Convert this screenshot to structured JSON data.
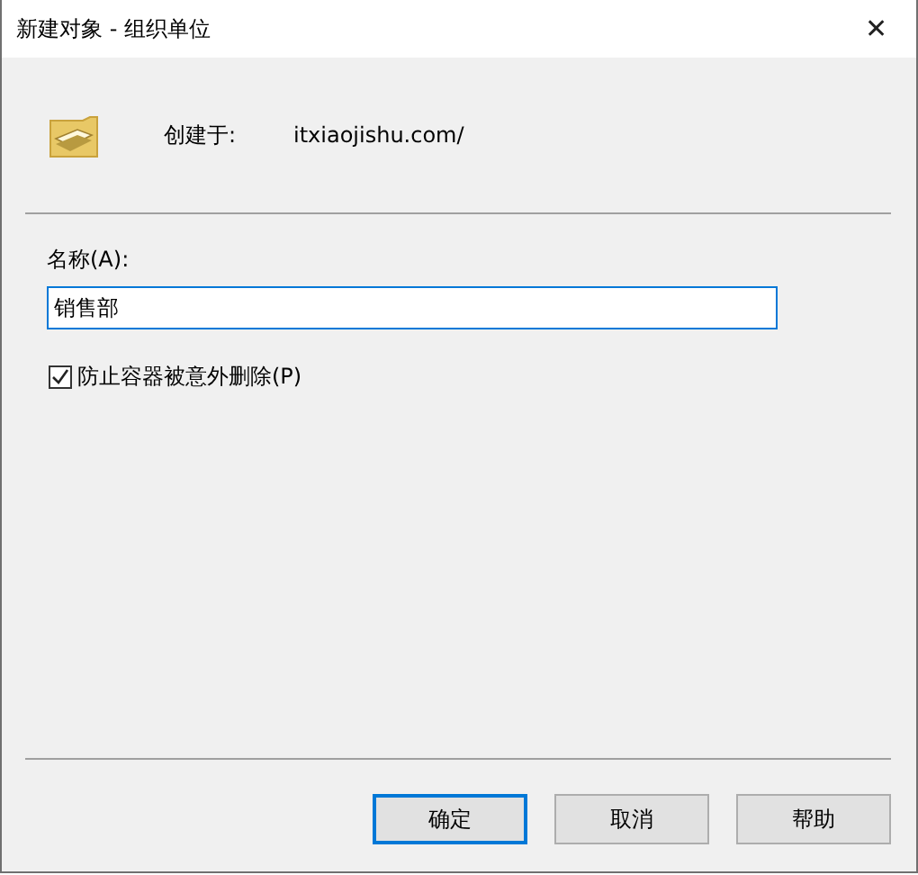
{
  "window": {
    "title": "新建对象 - 组织单位",
    "close": "✕"
  },
  "header": {
    "label": "创建于:",
    "value": "itxiaojishu.com/"
  },
  "name_field": {
    "label": "名称(A):",
    "value": "销售部"
  },
  "protect": {
    "label": "防止容器被意外删除(P)",
    "checked": true
  },
  "buttons": [
    {
      "label": "确定",
      "default": true
    },
    {
      "label": "取消",
      "default": false
    },
    {
      "label": "帮助",
      "default": false
    }
  ]
}
